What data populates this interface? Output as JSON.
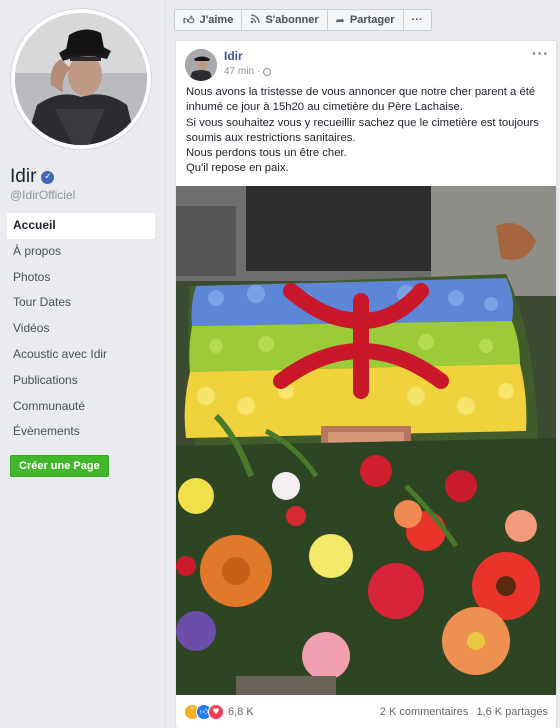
{
  "page": {
    "name": "Idir",
    "handle": "@IdirOfficiel"
  },
  "nav": {
    "items": [
      "Accueil",
      "À propos",
      "Photos",
      "Tour Dates",
      "Vidéos",
      "Acoustic avec Idir",
      "Publications",
      "Communauté",
      "Évènements"
    ],
    "active_index": 0,
    "create_page": "Créer une Page"
  },
  "actionbar": {
    "like": "J'aime",
    "subscribe": "S'abonner",
    "share": "Partager",
    "more": "···"
  },
  "post": {
    "author": "Idir",
    "time": "47 min",
    "paragraphs": [
      "Nous avons la tristesse de vous annoncer que notre cher parent a été inhumé ce jour à 15h20 au cimetière du Père Lachaise.",
      "Si vous souhaitez vous y recueillir sachez que le cimetière est toujours soumis aux restrictions sanitaires.",
      "Nous perdons tous un être cher.",
      "Qu'il repose en paix."
    ],
    "reactions_count": "6,8 K",
    "comments": "2 K commentaires",
    "shares": "1,6 K partages"
  },
  "colors": {
    "link": "#385898",
    "brand": "#4267b2",
    "create_button": "#42b72a"
  },
  "icons": [
    "verified-badge-icon",
    "thumbs-up-icon",
    "rss-icon",
    "share-arrow-icon",
    "globe-icon",
    "more-dots-icon",
    "sad-reaction-icon",
    "like-reaction-icon",
    "love-reaction-icon"
  ]
}
